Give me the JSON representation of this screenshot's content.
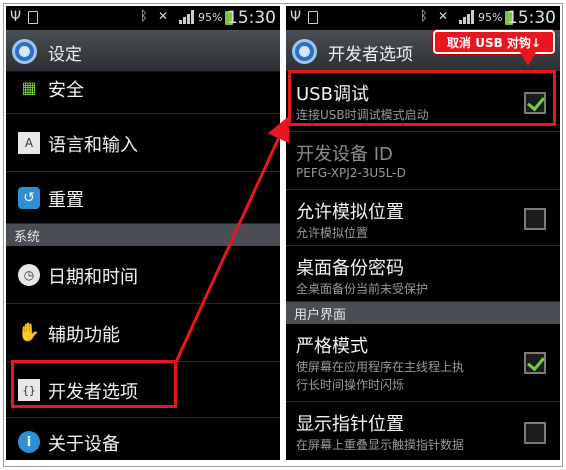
{
  "left": {
    "status": {
      "battery": "95%",
      "time": "15:30"
    },
    "title": "设定",
    "items": [
      {
        "label": "安全",
        "icon": "security-icon"
      },
      {
        "label": "语言和输入",
        "icon": "keyboard-icon"
      },
      {
        "label": "重置",
        "icon": "reset-icon"
      }
    ],
    "section": "系统",
    "system_items": [
      {
        "label": "日期和时间",
        "icon": "clock-icon"
      },
      {
        "label": "辅助功能",
        "icon": "hand-icon"
      },
      {
        "label": "开发者选项",
        "icon": "braces-icon"
      },
      {
        "label": "关于设备",
        "icon": "info-icon"
      }
    ]
  },
  "right": {
    "status": {
      "battery": "95%",
      "time": "15:30"
    },
    "title": "开发者选项",
    "callout": "取消 USB 对钩↓",
    "items": [
      {
        "title": "USB调试",
        "sub": "连接USB时调试模式启动",
        "checked": true
      },
      {
        "title": "开发设备 ID",
        "sub": "PEFG-XPJ2-3U5L-D"
      },
      {
        "title": "允许模拟位置",
        "sub": "允许模拟位置",
        "checked": false
      },
      {
        "title": "桌面备份密码",
        "sub": "全桌面备份当前未受保护"
      }
    ],
    "section": "用户界面",
    "ui_items": [
      {
        "title": "严格模式",
        "sub1": "使屏幕在应用程序在主线程上执",
        "sub2": "行长时间操作时闪烁",
        "checked": true
      },
      {
        "title": "显示指针位置",
        "sub": "在屏幕上重叠显示触摸指针数据",
        "checked": false
      }
    ]
  },
  "colors": {
    "highlight": "#e8161f",
    "check": "#6fd33a",
    "accent": "#2d6fc4"
  }
}
